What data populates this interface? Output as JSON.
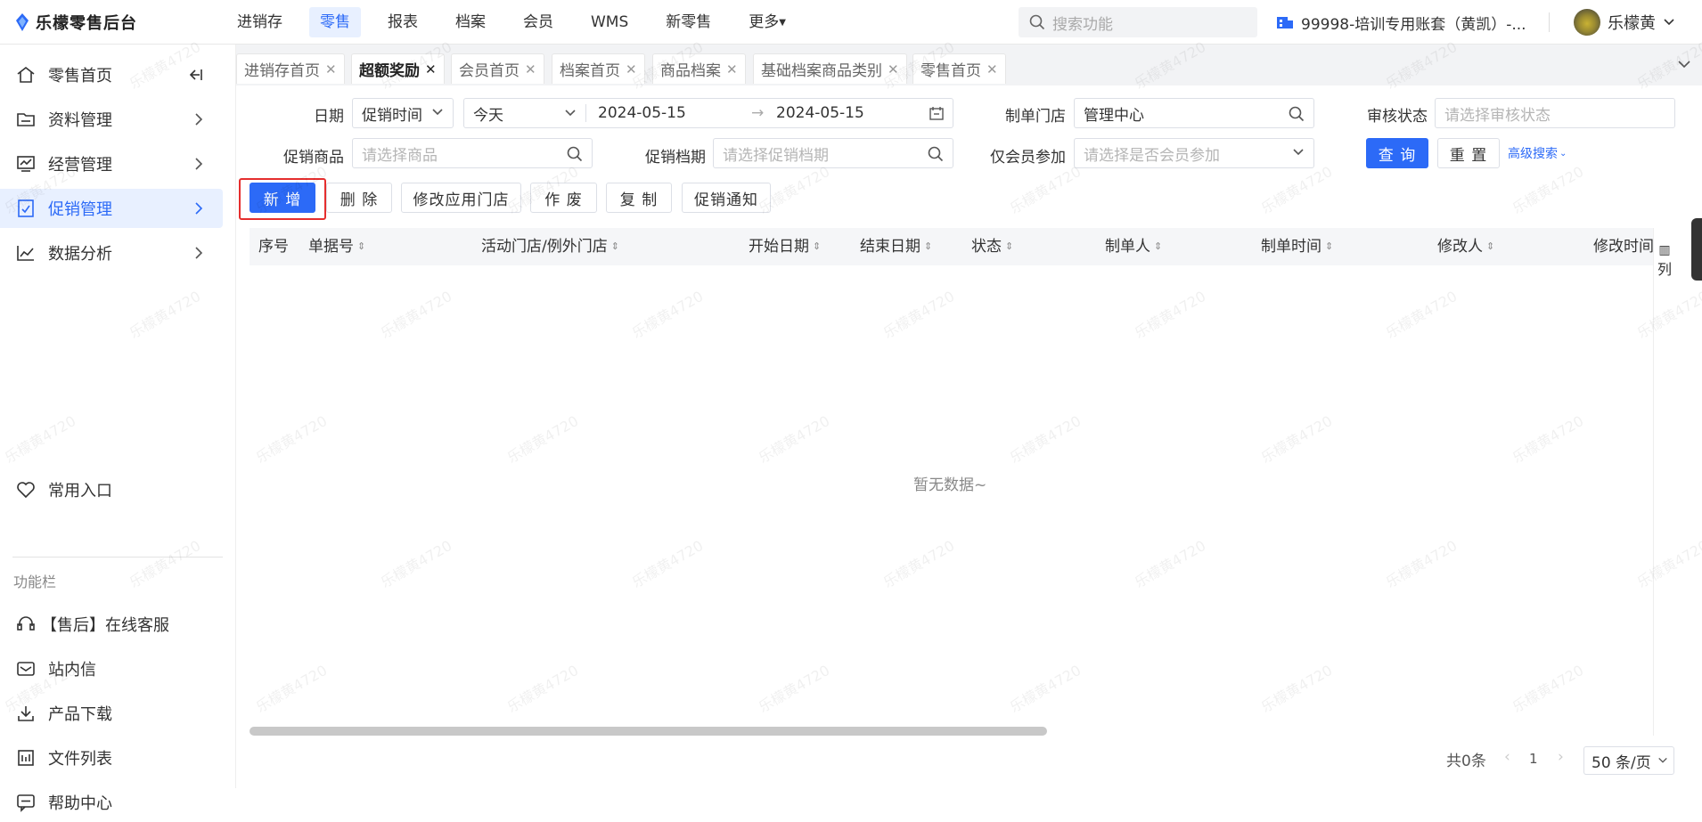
{
  "app": {
    "name": "乐檬零售后台"
  },
  "topnav": {
    "items": [
      "进销存",
      "零售",
      "报表",
      "档案",
      "会员",
      "WMS",
      "新零售",
      "更多"
    ],
    "active": "零售"
  },
  "search": {
    "placeholder": "搜索功能"
  },
  "account": {
    "label": "99998-培训专用账套（黄凯）-..."
  },
  "user": {
    "name": "乐檬黄"
  },
  "sidebar": {
    "collapse_icon": "collapse-left-icon",
    "items": [
      {
        "label": "零售首页",
        "icon": "home-icon"
      },
      {
        "label": "资料管理",
        "icon": "folder-icon"
      },
      {
        "label": "经营管理",
        "icon": "chart-icon"
      },
      {
        "label": "促销管理",
        "icon": "promo-icon"
      },
      {
        "label": "数据分析",
        "icon": "trend-icon"
      }
    ],
    "active": "促销管理",
    "favorites": {
      "label": "常用入口",
      "icon": "heart-icon"
    },
    "section_caption": "功能栏",
    "tools": [
      {
        "label": "【售后】在线客服",
        "icon": "headset-icon"
      },
      {
        "label": "站内信",
        "icon": "mail-icon"
      },
      {
        "label": "产品下载",
        "icon": "download-icon"
      },
      {
        "label": "文件列表",
        "icon": "file-list-icon"
      },
      {
        "label": "帮助中心",
        "icon": "help-icon"
      }
    ]
  },
  "tabs": [
    "进销存首页",
    "超额奖励",
    "会员首页",
    "档案首页",
    "商品档案",
    "基础档案商品类别",
    "零售首页"
  ],
  "active_tab": "超额奖励",
  "filters": {
    "date_label": "日期",
    "date_type": "促销时间",
    "date_range": "今天",
    "date_start": "2024-05-15",
    "date_end": "2024-05-15",
    "store_label": "制单门店",
    "store_value": "管理中心",
    "audit_label": "审核状态",
    "audit_placeholder": "请选择审核状态",
    "goods_label": "促销商品",
    "goods_placeholder": "请选择商品",
    "period_label": "促销档期",
    "period_placeholder": "请选择促销档期",
    "member_label": "仅会员参加",
    "member_placeholder": "请选择是否会员参加",
    "query": "查 询",
    "reset": "重 置",
    "advanced": "高级搜索"
  },
  "actions": [
    "新 增",
    "删 除",
    "修改应用门店",
    "作 废",
    "复 制",
    "促销通知"
  ],
  "table": {
    "columns": [
      "序号",
      "单据号",
      "活动门店/例外门店",
      "开始日期",
      "结束日期",
      "状态",
      "制单人",
      "制单时间",
      "修改人",
      "修改时间"
    ],
    "column_setting": "列",
    "empty": "暂无数据~"
  },
  "pagination": {
    "total": "共0条",
    "page": "1",
    "page_size": "50 条/页"
  },
  "watermark": "乐檬黄4720",
  "colors": {
    "primary": "#2c6af7",
    "highlight": "#e52e2e"
  }
}
